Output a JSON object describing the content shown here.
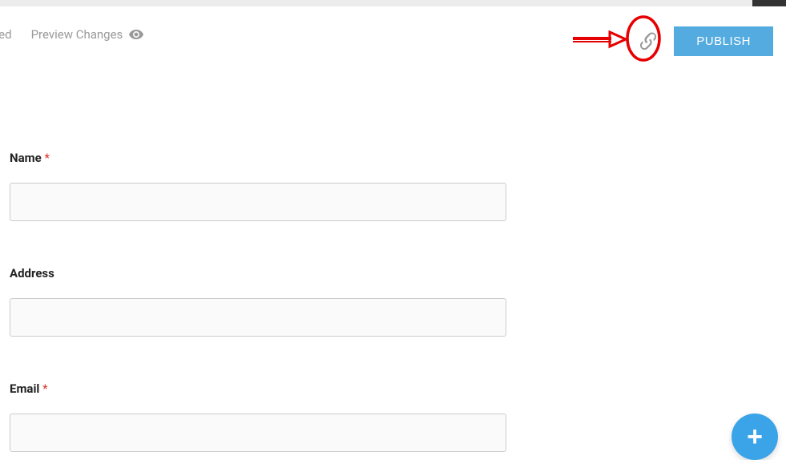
{
  "toolbar": {
    "partial_tab_label": "nced",
    "preview_label": "Preview Changes",
    "publish_label": "PUBLISH"
  },
  "form": {
    "fields": [
      {
        "label": "Name",
        "required": true
      },
      {
        "label": "Address",
        "required": false
      },
      {
        "label": "Email",
        "required": true
      }
    ],
    "required_marker": "*"
  },
  "fab": {
    "glyph": "+"
  }
}
